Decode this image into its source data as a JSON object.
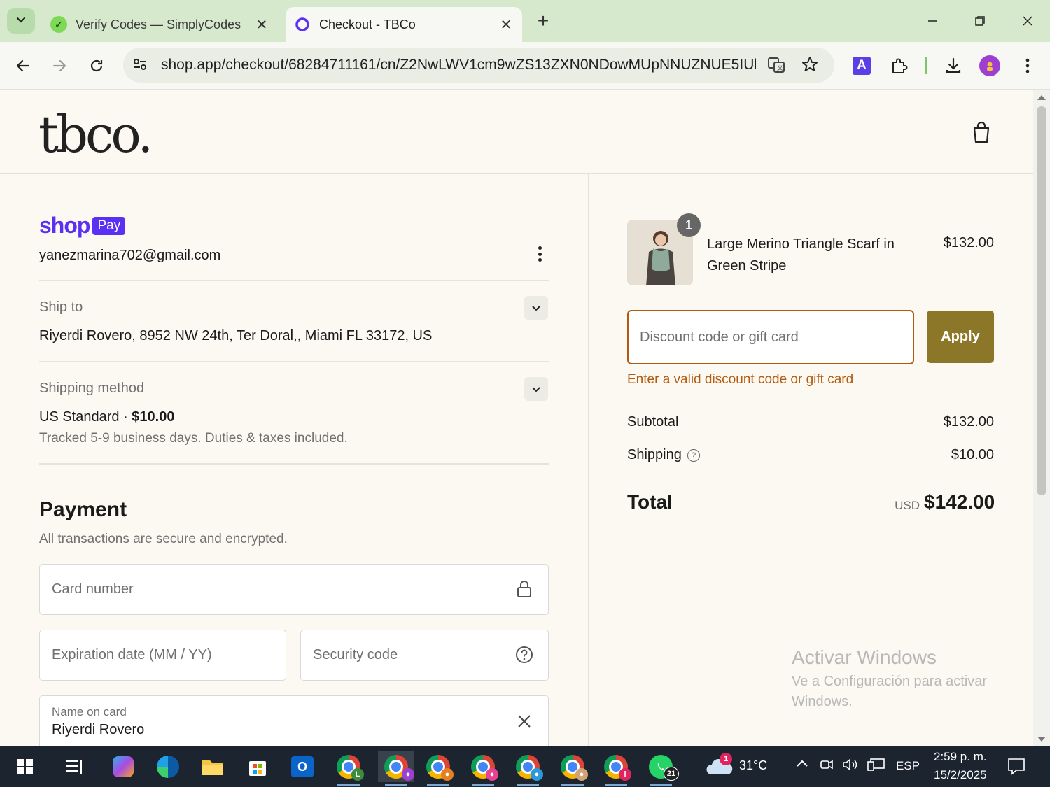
{
  "browser": {
    "tabs": [
      {
        "title": "Verify Codes — SimplyCodes",
        "active": false
      },
      {
        "title": "Checkout - TBCo",
        "active": true
      }
    ],
    "url": "shop.app/checkout/68284711161/cn/Z2NwLWV1cm9wZS13ZXN0NDowMUpNNUZNUE5IUk..."
  },
  "header": {
    "logo": "tbco."
  },
  "shop_pay": {
    "brand": "shop",
    "badge": "Pay",
    "email": "yanezmarina702@gmail.com"
  },
  "ship_to": {
    "label": "Ship to",
    "address": "Riyerdi Rovero, 8952 NW 24th, Ter Doral,, Miami FL 33172, US"
  },
  "shipping_method": {
    "label": "Shipping method",
    "name": "US Standard",
    "separator": " · ",
    "price": "$10.00",
    "note": "Tracked 5-9 business days. Duties & taxes included."
  },
  "payment": {
    "title": "Payment",
    "subtitle": "All transactions are secure and encrypted.",
    "card_number_placeholder": "Card number",
    "expiry_placeholder": "Expiration date (MM / YY)",
    "security_placeholder": "Security code",
    "name_label": "Name on card",
    "name_value": "Riyerdi Rovero"
  },
  "order": {
    "quantity": "1",
    "product_name": "Large Merino Triangle Scarf in Green Stripe",
    "product_price": "$132.00",
    "discount_placeholder": "Discount code or gift card",
    "apply_label": "Apply",
    "error": "Enter a valid discount code or gift card",
    "subtotal_label": "Subtotal",
    "subtotal": "$132.00",
    "shipping_label": "Shipping",
    "shipping": "$10.00",
    "total_label": "Total",
    "currency": "USD",
    "total": "$142.00"
  },
  "watermark": {
    "title": "Activar Windows",
    "body": "Ve a Configuración para activar Windows."
  },
  "taskbar": {
    "weather_badge": "1",
    "temperature": "31°C",
    "language": "ESP",
    "time": "2:59 p. m.",
    "date": "15/2/2025",
    "whatsapp_badge": "21"
  },
  "colors": {
    "accent_apply": "#8c7628",
    "error": "#b45a10",
    "shop_pay": "#5a31f4",
    "tab_strip": "#d6e9cd"
  }
}
